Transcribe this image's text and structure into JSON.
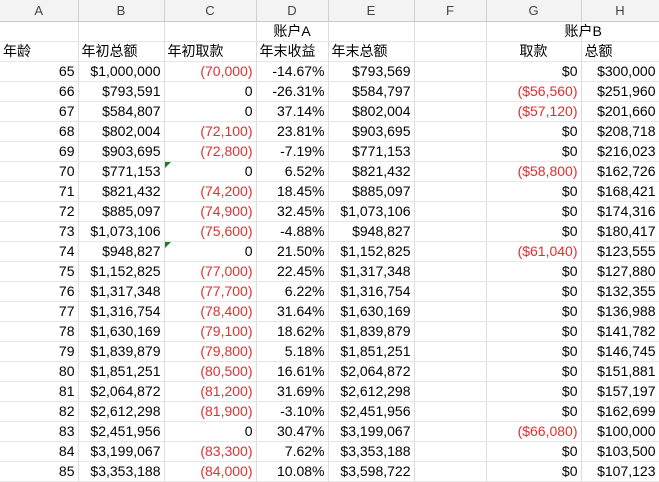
{
  "columns": [
    "A",
    "B",
    "C",
    "D",
    "E",
    "F",
    "G",
    "H"
  ],
  "groups": {
    "account_a": "账户A",
    "account_b": "账户B"
  },
  "headers": {
    "age": "年龄",
    "start_balance": "年初总额",
    "start_withdraw": "年初取款",
    "year_return": "年末收益",
    "end_balance": "年末总额",
    "b_withdraw": "取款",
    "b_total": "总额"
  },
  "rows": [
    {
      "age": "65",
      "start": "$1,000,000",
      "withdraw": "(70,000)",
      "ret": "-14.67%",
      "end": "$793,569",
      "bw": "$0",
      "bt": "$300,000"
    },
    {
      "age": "66",
      "start": "$793,591",
      "withdraw": "0",
      "ret": "-26.31%",
      "end": "$584,797",
      "bw": "($56,560)",
      "bt": "$251,960"
    },
    {
      "age": "67",
      "start": "$584,807",
      "withdraw": "0",
      "ret": "37.14%",
      "end": "$802,004",
      "bw": "($57,120)",
      "bt": "$201,660"
    },
    {
      "age": "68",
      "start": "$802,004",
      "withdraw": "(72,100)",
      "ret": "23.81%",
      "end": "$903,695",
      "bw": "$0",
      "bt": "$208,718"
    },
    {
      "age": "69",
      "start": "$903,695",
      "withdraw": "(72,800)",
      "ret": "-7.19%",
      "end": "$771,153",
      "bw": "$0",
      "bt": "$216,023"
    },
    {
      "age": "70",
      "start": "$771,153",
      "withdraw": "0",
      "ret": "6.52%",
      "end": "$821,432",
      "bw": "($58,800)",
      "bt": "$162,726"
    },
    {
      "age": "71",
      "start": "$821,432",
      "withdraw": "(74,200)",
      "ret": "18.45%",
      "end": "$885,097",
      "bw": "$0",
      "bt": "$168,421"
    },
    {
      "age": "72",
      "start": "$885,097",
      "withdraw": "(74,900)",
      "ret": "32.45%",
      "end": "$1,073,106",
      "bw": "$0",
      "bt": "$174,316"
    },
    {
      "age": "73",
      "start": "$1,073,106",
      "withdraw": "(75,600)",
      "ret": "-4.88%",
      "end": "$948,827",
      "bw": "$0",
      "bt": "$180,417"
    },
    {
      "age": "74",
      "start": "$948,827",
      "withdraw": "0",
      "ret": "21.50%",
      "end": "$1,152,825",
      "bw": "($61,040)",
      "bt": "$123,555"
    },
    {
      "age": "75",
      "start": "$1,152,825",
      "withdraw": "(77,000)",
      "ret": "22.45%",
      "end": "$1,317,348",
      "bw": "$0",
      "bt": "$127,880"
    },
    {
      "age": "76",
      "start": "$1,317,348",
      "withdraw": "(77,700)",
      "ret": "6.22%",
      "end": "$1,316,754",
      "bw": "$0",
      "bt": "$132,355"
    },
    {
      "age": "77",
      "start": "$1,316,754",
      "withdraw": "(78,400)",
      "ret": "31.64%",
      "end": "$1,630,169",
      "bw": "$0",
      "bt": "$136,988"
    },
    {
      "age": "78",
      "start": "$1,630,169",
      "withdraw": "(79,100)",
      "ret": "18.62%",
      "end": "$1,839,879",
      "bw": "$0",
      "bt": "$141,782"
    },
    {
      "age": "79",
      "start": "$1,839,879",
      "withdraw": "(79,800)",
      "ret": "5.18%",
      "end": "$1,851,251",
      "bw": "$0",
      "bt": "$146,745"
    },
    {
      "age": "80",
      "start": "$1,851,251",
      "withdraw": "(80,500)",
      "ret": "16.61%",
      "end": "$2,064,872",
      "bw": "$0",
      "bt": "$151,881"
    },
    {
      "age": "81",
      "start": "$2,064,872",
      "withdraw": "(81,200)",
      "ret": "31.69%",
      "end": "$2,612,298",
      "bw": "$0",
      "bt": "$157,197"
    },
    {
      "age": "82",
      "start": "$2,612,298",
      "withdraw": "(81,900)",
      "ret": "-3.10%",
      "end": "$2,451,956",
      "bw": "$0",
      "bt": "$162,699"
    },
    {
      "age": "83",
      "start": "$2,451,956",
      "withdraw": "0",
      "ret": "30.47%",
      "end": "$3,199,067",
      "bw": "($66,080)",
      "bt": "$100,000"
    },
    {
      "age": "84",
      "start": "$3,199,067",
      "withdraw": "(83,300)",
      "ret": "7.62%",
      "end": "$3,353,188",
      "bw": "$0",
      "bt": "$103,500"
    },
    {
      "age": "85",
      "start": "$3,353,188",
      "withdraw": "(84,000)",
      "ret": "10.08%",
      "end": "$3,598,722",
      "bw": "$0",
      "bt": "$107,123"
    }
  ]
}
